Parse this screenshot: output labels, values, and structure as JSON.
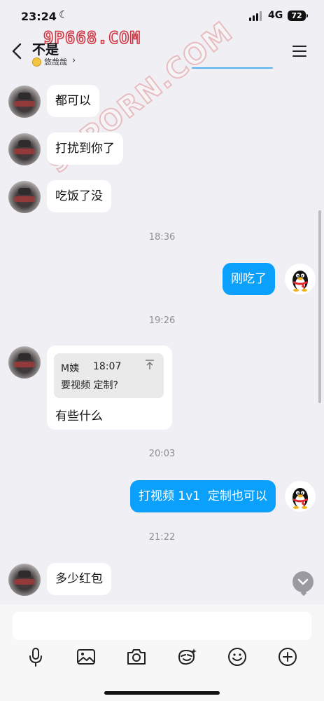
{
  "status_bar": {
    "time": "23:24",
    "network": "4G",
    "battery": "72"
  },
  "watermarks": {
    "top": "9P668.COM",
    "diagonal": "91PORN.COM"
  },
  "header": {
    "title": "不是",
    "subtitle": "悠哉哉"
  },
  "messages": [
    {
      "side": "left",
      "text": "都可以"
    },
    {
      "side": "left",
      "text": "打扰到你了"
    },
    {
      "side": "left",
      "text": "吃饭了没"
    },
    {
      "type": "time",
      "text": "18:36"
    },
    {
      "side": "right",
      "text": "刚吃了"
    },
    {
      "type": "time",
      "text": "19:26"
    },
    {
      "side": "left",
      "quote": {
        "name": "M姨",
        "time": "18:07",
        "text": "要视频 定制?"
      },
      "text": "有些什么"
    },
    {
      "type": "time",
      "text": "20:03"
    },
    {
      "side": "right",
      "text": "打视频 1v1  定制也可以"
    },
    {
      "type": "time",
      "text": "21:22"
    },
    {
      "side": "left",
      "text": "多少红包"
    }
  ],
  "toolbar": [
    "microphone-icon",
    "image-icon",
    "camera-icon",
    "sticker-icon",
    "emoji-icon",
    "plus-icon"
  ],
  "colors": {
    "bubble_blue": "#0ba0fb",
    "background": "#efeff4"
  }
}
